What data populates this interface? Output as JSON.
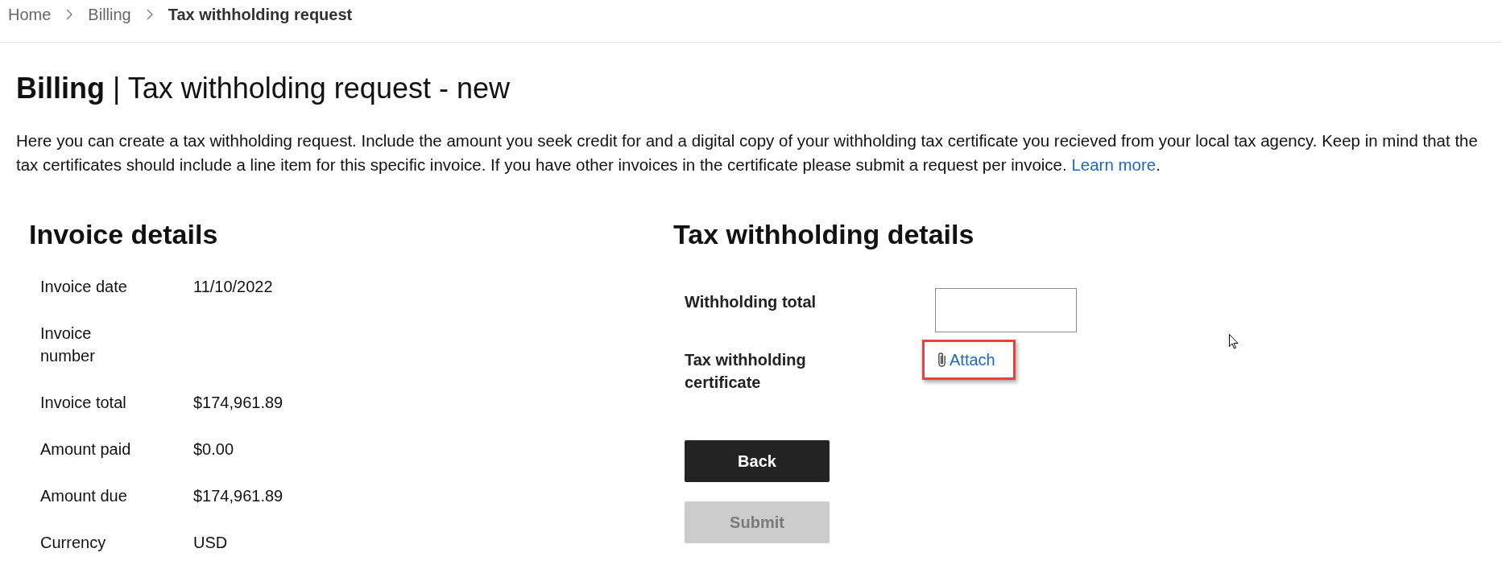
{
  "breadcrumb": [
    {
      "label": "Home",
      "current": false
    },
    {
      "label": "Billing",
      "current": false
    },
    {
      "label": "Tax withholding request",
      "current": true
    }
  ],
  "page_title": "**Billing** | Tax withholding request - new",
  "description": {
    "text": "Here you can create a tax withholding request. Include the amount you seek credit for and a digital copy of your withholding tax certificate you recieved from your local tax agency. Keep in mind that the tax certificates should include a line item for this specific invoice. If you have other invoices in the certificate please submit a request per invoice.",
    "link": "Learn more",
    "trailing": "."
  },
  "invoice_details": {
    "title": "Invoice details",
    "rows": [
      {
        "label": "Invoice date",
        "value": "11/10/2022"
      },
      {
        "label": "Invoice number"
      },
      {
        "label": "Invoice total",
        "value": "$174,961.89"
      },
      {
        "label": "Amount paid",
        "value": "$0.00"
      },
      {
        "label": "Amount due",
        "value": "$174,961.89"
      },
      {
        "label": "Currency",
        "value": "USD"
      }
    ]
  },
  "tax_withholding_details": {
    "title": "Tax withholding details",
    "fields": [
      {
        "kind": "input",
        "label": "Withholding total"
      },
      {
        "kind": "attach",
        "label": "Tax withholding certificate",
        "link": "Attach",
        "highlighted": true
      }
    ]
  },
  "buttons": [
    {
      "label": "Back",
      "disabled": false
    },
    {
      "label": "Submit",
      "disabled": true
    }
  ]
}
